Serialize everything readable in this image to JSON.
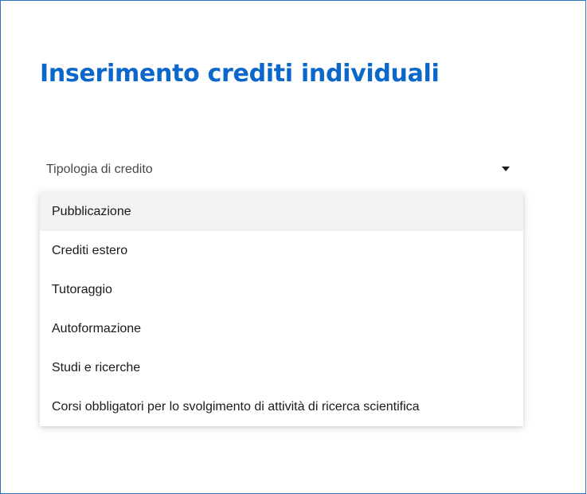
{
  "page": {
    "title": "Inserimento crediti individuali"
  },
  "select": {
    "label": "Tipologia di credito",
    "caret_icon": "caret-down-icon"
  },
  "dropdown": {
    "highlighted_index": 0,
    "options": [
      {
        "label": "Pubblicazione"
      },
      {
        "label": "Crediti estero"
      },
      {
        "label": "Tutoraggio"
      },
      {
        "label": "Autoformazione"
      },
      {
        "label": "Studi e ricerche"
      },
      {
        "label": "Corsi obbligatori per lo svolgimento di attività di ricerca scientifica"
      }
    ]
  },
  "colors": {
    "title": "#0b67c9",
    "frame_border": "#2f6fc4",
    "highlight_bg": "#f2f2f2"
  }
}
